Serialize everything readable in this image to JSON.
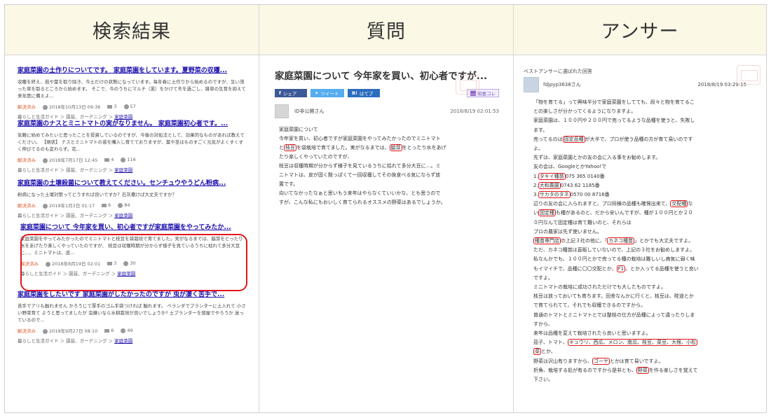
{
  "headers": {
    "search": "検索結果",
    "question": "質問",
    "answer": "アンサー"
  },
  "results": [
    {
      "title": "家庭菜園の土作りについてです。 家庭菜園をしています。夏野菜の収穫...",
      "snippet": "収穫を終え、茄や葉を取り除き、今土だけの状態になっています。毎年春に土作りから始めるのですが、生い茂った草を取るところから始めます。 そこで、今のうちにマルチ（黒）をかけて冬を過ごし、雑草の生育を抑えて来年度に備えよ...",
      "status": "解決済み",
      "date": "2018年10月13日 09:36",
      "answers": "3",
      "views": "57",
      "category": "暮らしと生活ガイド ＞ 園芸、ガーデニング ＞ ",
      "category_link": "家庭菜園"
    },
    {
      "title": "家庭菜園のナスとミニトマトの実がなりません。 家庭菜園初心者です。...",
      "snippet": "気軽に始めてみたいと思ったことを投資しているのですが、今後の対処法として、効果的なものがあれば教えてください。 【現状】 ナスとミニトマトの苗を購入し育てておりますが、葉や茎はものすごく元気がよくすくすく伸びてるのも変わらず。花...",
      "status": "解決済み",
      "date": "2018年7月17日 12:45",
      "answers": "4",
      "views": "116",
      "category": "暮らしと生活ガイド ＞ 園芸、ガーデニング ＞ ",
      "category_link": "家庭菜園"
    },
    {
      "title": "家庭菜園の土壌殺菌について教えてください。センチュウやうどん粉病...",
      "snippet": "粉病になった土壌対策ってどうすれば良いですか？石灰撒けば大丈夫ですか？",
      "status": "解決済み",
      "date": "2019年1月3日 01:17",
      "answers": "6",
      "views": "84",
      "category": "暮らしと生活ガイド ＞ 園芸、ガーデニング ＞ ",
      "category_link": "家庭菜園"
    },
    {
      "title": "家庭菜園について 今年家を買い、初心者ですが家庭菜園をやってみたか...",
      "snippet": "家庭菜園をやってみたかったのでミニトマトと枝豆を袋栽培で育てました。実がなるまでは、脇芽をとったり水をあげたり楽しくやっていたのですが、 枝豆は収穫時期が分からず様子を見ているうちに枯れて多分大豆に...、ミニトマトは、皮...",
      "status": "解決済み",
      "date": "2018年8月19日 02:01",
      "answers": "3",
      "views": "30",
      "category": "暮らしと生活ガイド ＞ 園芸、ガーデニング ＞ ",
      "category_link": "家庭菜園"
    },
    {
      "title": "家庭菜園をしたいです 家庭菜園がしたかったのですが 虫が凄く苦手で...",
      "snippet": "苦手でアリも触れません かろうじて厚手のゴム手袋つければ 触れます。 ベランダでプランターに土入れて 小さい野菜育て ようと思ってましたが 虫嫌いなら水耕栽培が良いでしょうか? 土プランターを部屋でやろうか 迷っているので...",
      "status": "解決済み",
      "date": "2019年9月27日 08:10",
      "answers": "6",
      "views": "49",
      "category": "暮らしと生活ガイド ＞ 園芸、ガーデニング ＞ ",
      "category_link": "家庭菜園"
    }
  ],
  "question": {
    "title": "家庭菜園について 今年家を買い、初心者ですが...",
    "share_fb": "シェア",
    "share_tw": "ツイート",
    "share_hb": "はてブ",
    "chie": "知恵コレ",
    "user": "ID非公開さん",
    "date": "2018/8/19 02:01:53",
    "l1": "家庭菜園について",
    "l2": "今年家を買い、初心者ですが家庭菜園をやってみたかったのでミニトマト",
    "l3a": "と",
    "l3b": "枝豆",
    "l3c": "を袋栽培で育てました。実がなるまでは、",
    "l3d": "脇芽",
    "l3e": "をとったり水をあげ",
    "l4": "たり楽しくやっていたのですが、",
    "l5": "枝豆は収穫時期が分からず様子を見ているうちに枯れて多分大豆に…。ミ",
    "l6": "ニトマトは、皮が固く酸っぱくて一回収穫してその後食べる気にならず放",
    "l7": "置です。",
    "l8": "向いてなかったなぁと思いもう来年はやらなくていいかな、とも思うので",
    "l9": "すが、こんな私にもおいしく育てられるオススメの野菜はあるでしょうか。"
  },
  "answer": {
    "label": "ベストアンサーに選ばれた回答",
    "user": "fdjpyp3638さん",
    "date": "2018/8/19 03:29:15",
    "a1": "「物を育てる」って興味半分で家庭菜園をしてても、段々と物を育てるこ",
    "a2": "との楽しさが分かってくるようになりますよ。",
    "a3": "家庭菜園は、１００円や２００円で売ってるような品種を使うと、失敗し",
    "a4": "ます。",
    "a5a": "売ってるのは",
    "a5b": "固定品種",
    "a5c": "が大半で、プロが使う品種の方が育て易いのです",
    "a6": "よ。",
    "a7": "先ずは、家庭菜園とかの友の会に入る事をお勧めします。",
    "a8": "友の会は、GoogleとかYahoo!で",
    "a9a": "1.",
    "a9b": "タキイ種苗",
    "a9c": "075 365 0140番",
    "a10a": "2.",
    "a10b": "大和農園",
    "a10c": "0743 62 1185番",
    "a11a": "3.",
    "a11b": "サカタのタネ",
    "a11c": "0570 00 8716番",
    "a12a": "辺りの友の会に入られますと、プロ同様の品種も確保出来て、",
    "a12b": "交配種",
    "a12c": "な",
    "a13a": "い",
    "a13b": "固定種",
    "a13c": "も種があるのと、だから安いんですが、種が１００円とか２０",
    "a14": "０円なんて固定種は育て難いのと、それらは",
    "a15": "プロの農家は先ず使いません。",
    "a16a": "",
    "a16b": "種苗専門店",
    "a16c": "の上記３社の他に、「",
    "a16d": "カネコ種苗",
    "a16e": "」とかでも大丈夫ですよ。",
    "a17": "ただ、カネコ種苗は直販していないので、上記の３社をお勧めしますよ。",
    "a18": "私なんかでも、１００円とかで売ってる種の栽培は難しいし病気に弱く味",
    "a19a": "もイマイチで、品種に〇〇交配とか、",
    "a19b": "F1",
    "a19c": "、とか入ってる品種を使うと良い",
    "a20": "ですよ。",
    "a21": "ミニトマトの栽培に成功されただけでも大したものですよ。",
    "a22": "枝豆は放っておいても育ちます。田舎なんかに行くと、枝豆は、畦道とか",
    "a23": "で育てられてて、それでも収穫できるのですから。",
    "a24": "普通のトマトとミニトマトとでは整枝の仕方が品種によって違ったりしま",
    "a25": "すから、",
    "a26": "来年は品種を変えて栽培されたら良いと思いますよ。",
    "a27a": "茄子、トマト、",
    "a27b": "キュウリ、西瓜、メロン、南瓜、枝豆、菜豆、大根、小松",
    "a28a": "菜",
    "a28b": "とか、",
    "a29a": "野菜は沢山有りますから、",
    "a29b": "ゴーヤ",
    "a29c": "とかは育て易いですよ。",
    "a30a": "折角、栽培する処が有るのですから是非とも、",
    "a30b": "野菜",
    "a30c": "を作る楽しさを覚えて",
    "a31": "下さい。"
  }
}
